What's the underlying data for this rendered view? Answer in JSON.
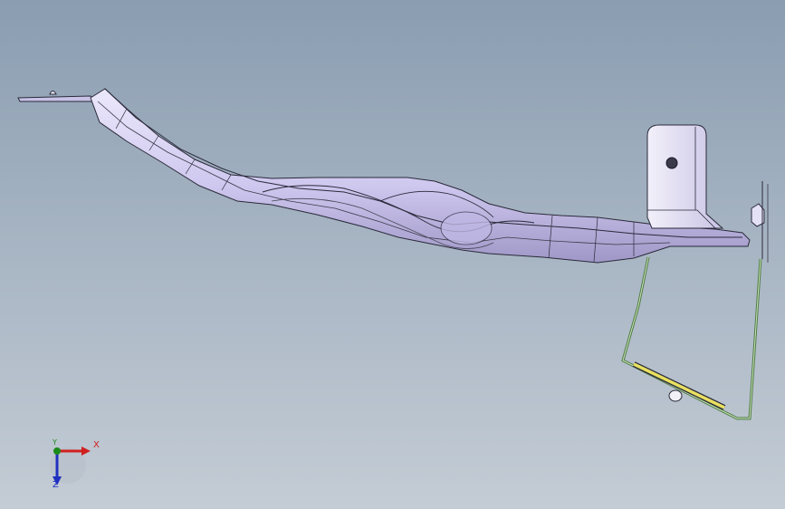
{
  "viewport": {
    "background_top": "#8a9db1",
    "background_bottom": "#c4ccd5"
  },
  "model": {
    "part_color": "#d6d0f0",
    "part_shadow": "#a69fcc",
    "edge_color": "#2a2a3a",
    "wire_color": "#5a8a4a",
    "highlight_color": "#e8e060"
  },
  "triad": {
    "x_label": "X",
    "y_label": "Y",
    "z_label": "Z",
    "x_color": "#d02020",
    "y_color": "#1a8a1a",
    "z_color": "#2030c0"
  }
}
